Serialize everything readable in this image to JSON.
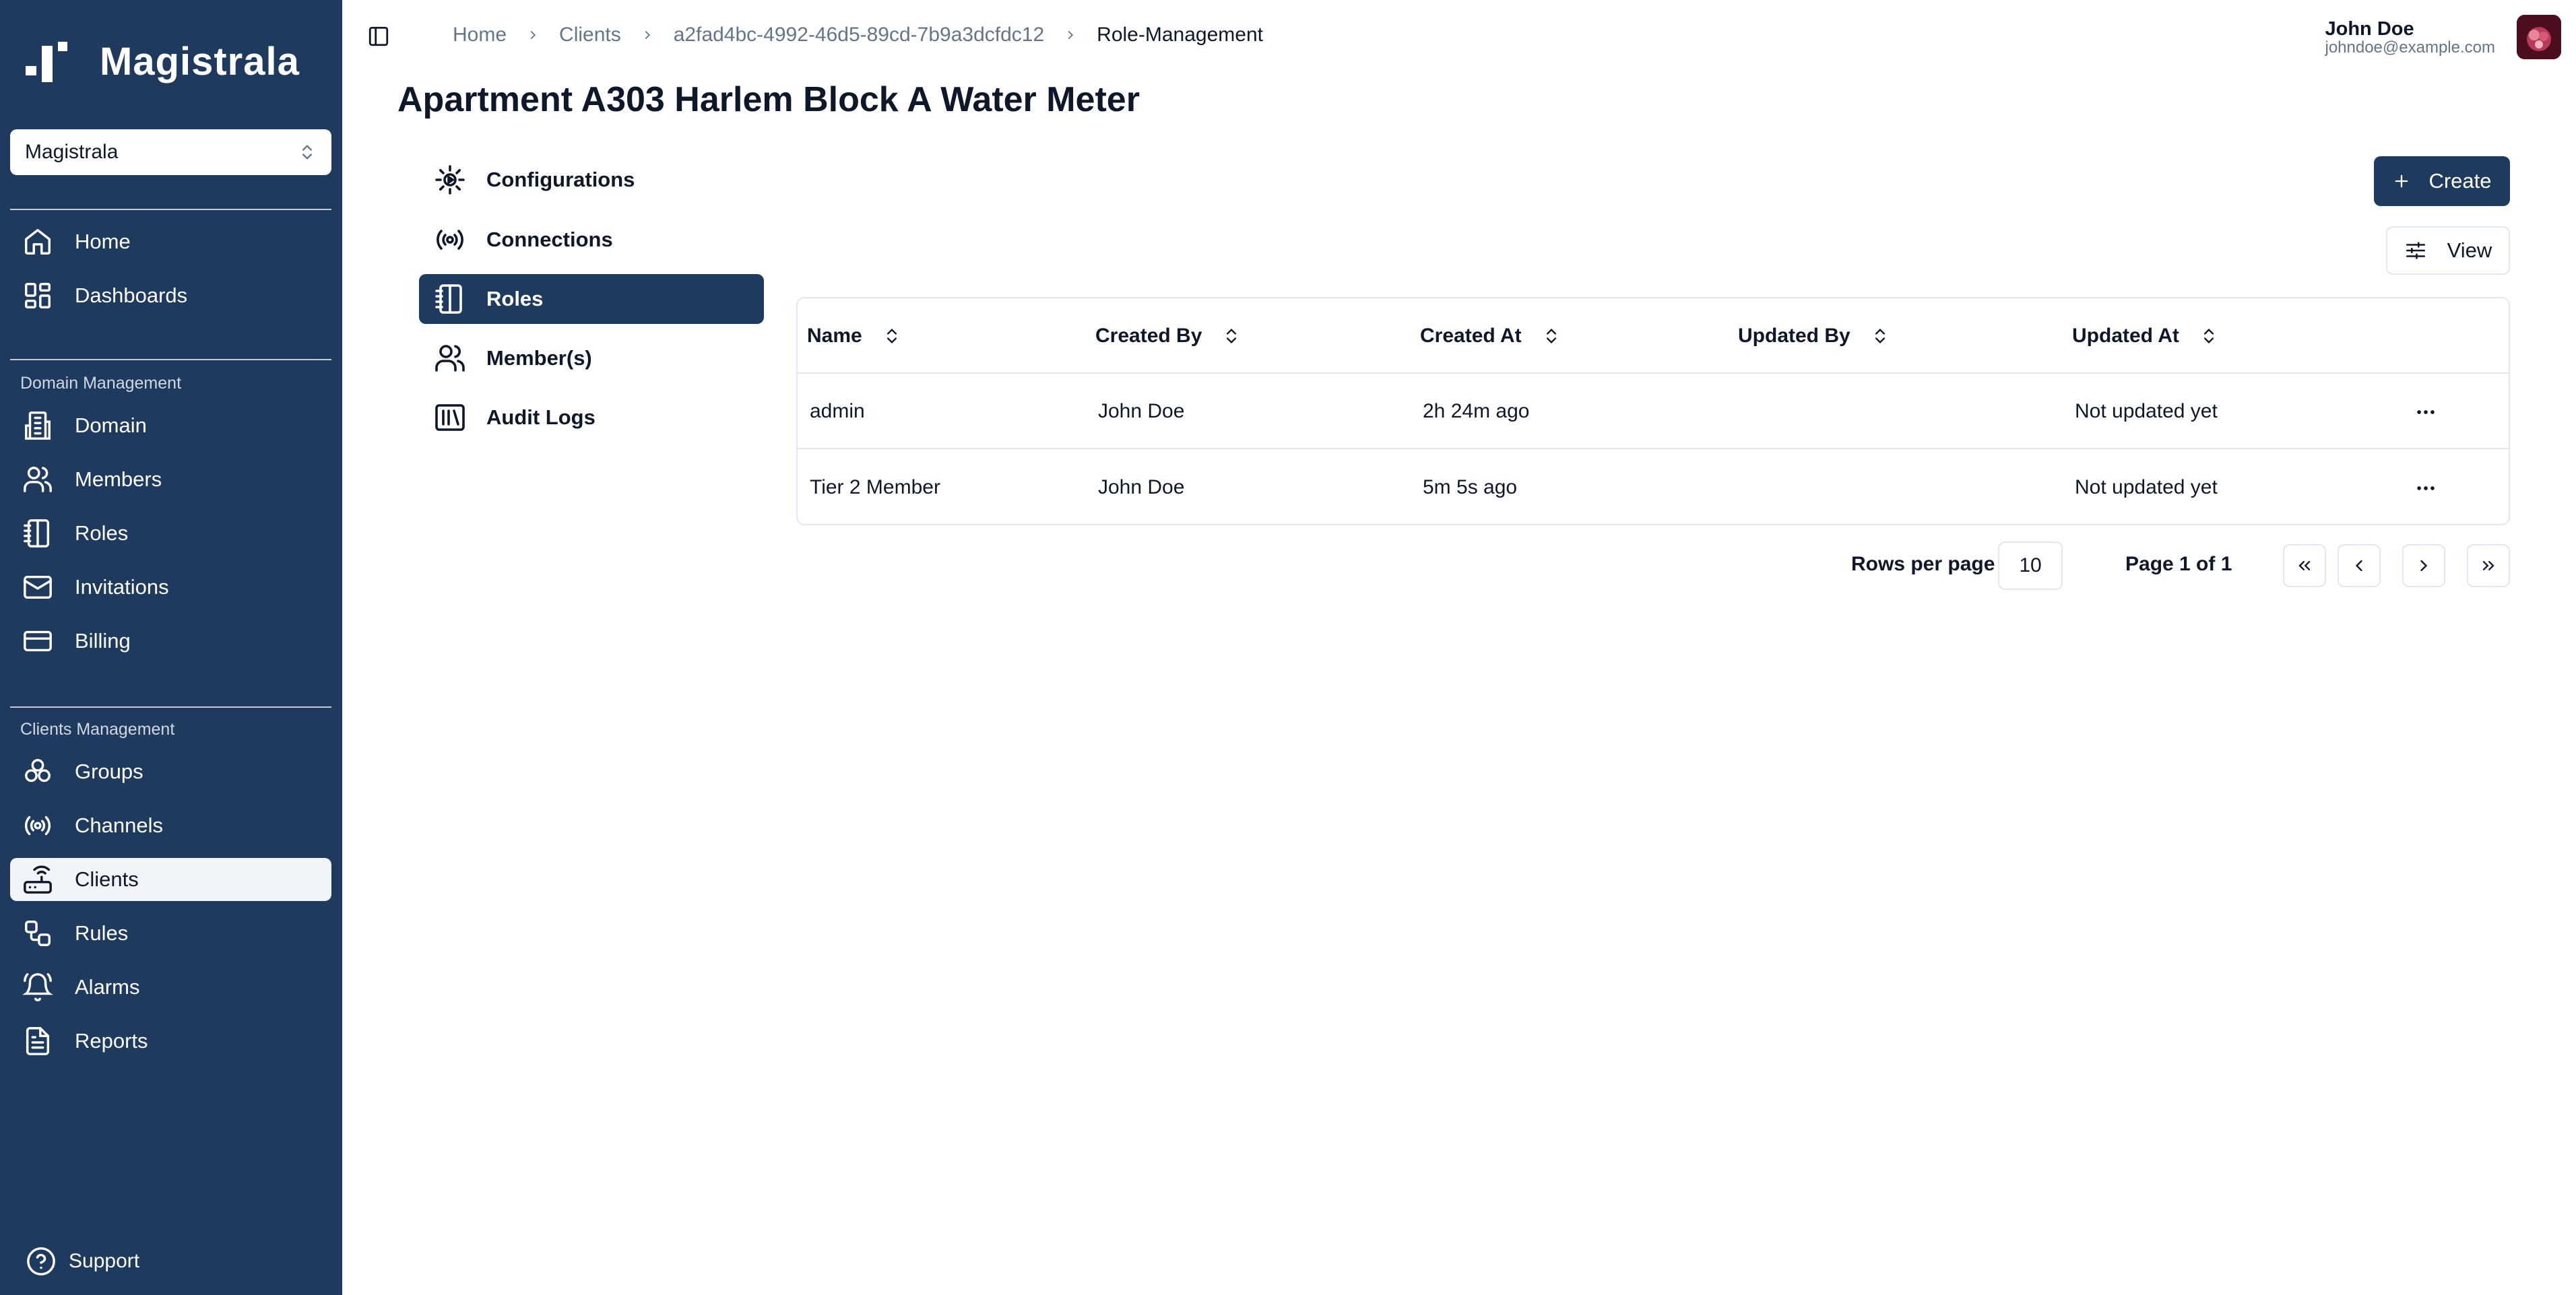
{
  "app": {
    "name": "Magistrala"
  },
  "sidebar": {
    "domain_select": "Magistrala",
    "main_items": [
      {
        "label": "Home",
        "icon": "home-icon"
      },
      {
        "label": "Dashboards",
        "icon": "dashboard-icon"
      }
    ],
    "domain_group_label": "Domain Management",
    "domain_items": [
      {
        "label": "Domain",
        "icon": "building-icon"
      },
      {
        "label": "Members",
        "icon": "users-icon"
      },
      {
        "label": "Roles",
        "icon": "notebook-icon"
      },
      {
        "label": "Invitations",
        "icon": "mail-icon"
      },
      {
        "label": "Billing",
        "icon": "credit-card-icon"
      }
    ],
    "clients_group_label": "Clients Management",
    "clients_items": [
      {
        "label": "Groups",
        "icon": "groups-icon"
      },
      {
        "label": "Channels",
        "icon": "radio-icon"
      },
      {
        "label": "Clients",
        "icon": "router-icon",
        "active": true
      },
      {
        "label": "Rules",
        "icon": "workflow-icon"
      },
      {
        "label": "Alarms",
        "icon": "bell-icon"
      },
      {
        "label": "Reports",
        "icon": "file-icon"
      }
    ],
    "support_label": "Support"
  },
  "header": {
    "breadcrumb": [
      "Home",
      "Clients",
      "a2fad4bc-4992-46d5-89cd-7b9a3dcfdc12",
      "Role-Management"
    ],
    "user_name": "John Doe",
    "user_email": "johndoe@example.com"
  },
  "page": {
    "title": "Apartment A303 Harlem Block A Water Meter",
    "subnav": [
      {
        "label": "Configurations",
        "icon": "settings-icon"
      },
      {
        "label": "Connections",
        "icon": "radio-icon"
      },
      {
        "label": "Roles",
        "icon": "notebook-icon",
        "active": true
      },
      {
        "label": "Member(s)",
        "icon": "users-icon"
      },
      {
        "label": "Audit Logs",
        "icon": "library-icon"
      }
    ],
    "create_label": "Create",
    "view_label": "View"
  },
  "table": {
    "columns": [
      "Name",
      "Created By",
      "Created At",
      "Updated By",
      "Updated At"
    ],
    "rows": [
      {
        "name": "admin",
        "created_by": "John Doe",
        "created_at": "2h 24m ago",
        "updated_by": "",
        "updated_at": "Not updated yet"
      },
      {
        "name": "Tier 2 Member",
        "created_by": "John Doe",
        "created_at": "5m 5s ago",
        "updated_by": "",
        "updated_at": "Not updated yet"
      }
    ]
  },
  "pagination": {
    "rows_per_page_label": "Rows per page",
    "rows_per_page_value": "10",
    "page_info": "Page 1 of 1"
  },
  "colors": {
    "sidebar_bg": "#1e3a5f",
    "accent": "#1e3a5f",
    "border": "#e2e8f0"
  }
}
